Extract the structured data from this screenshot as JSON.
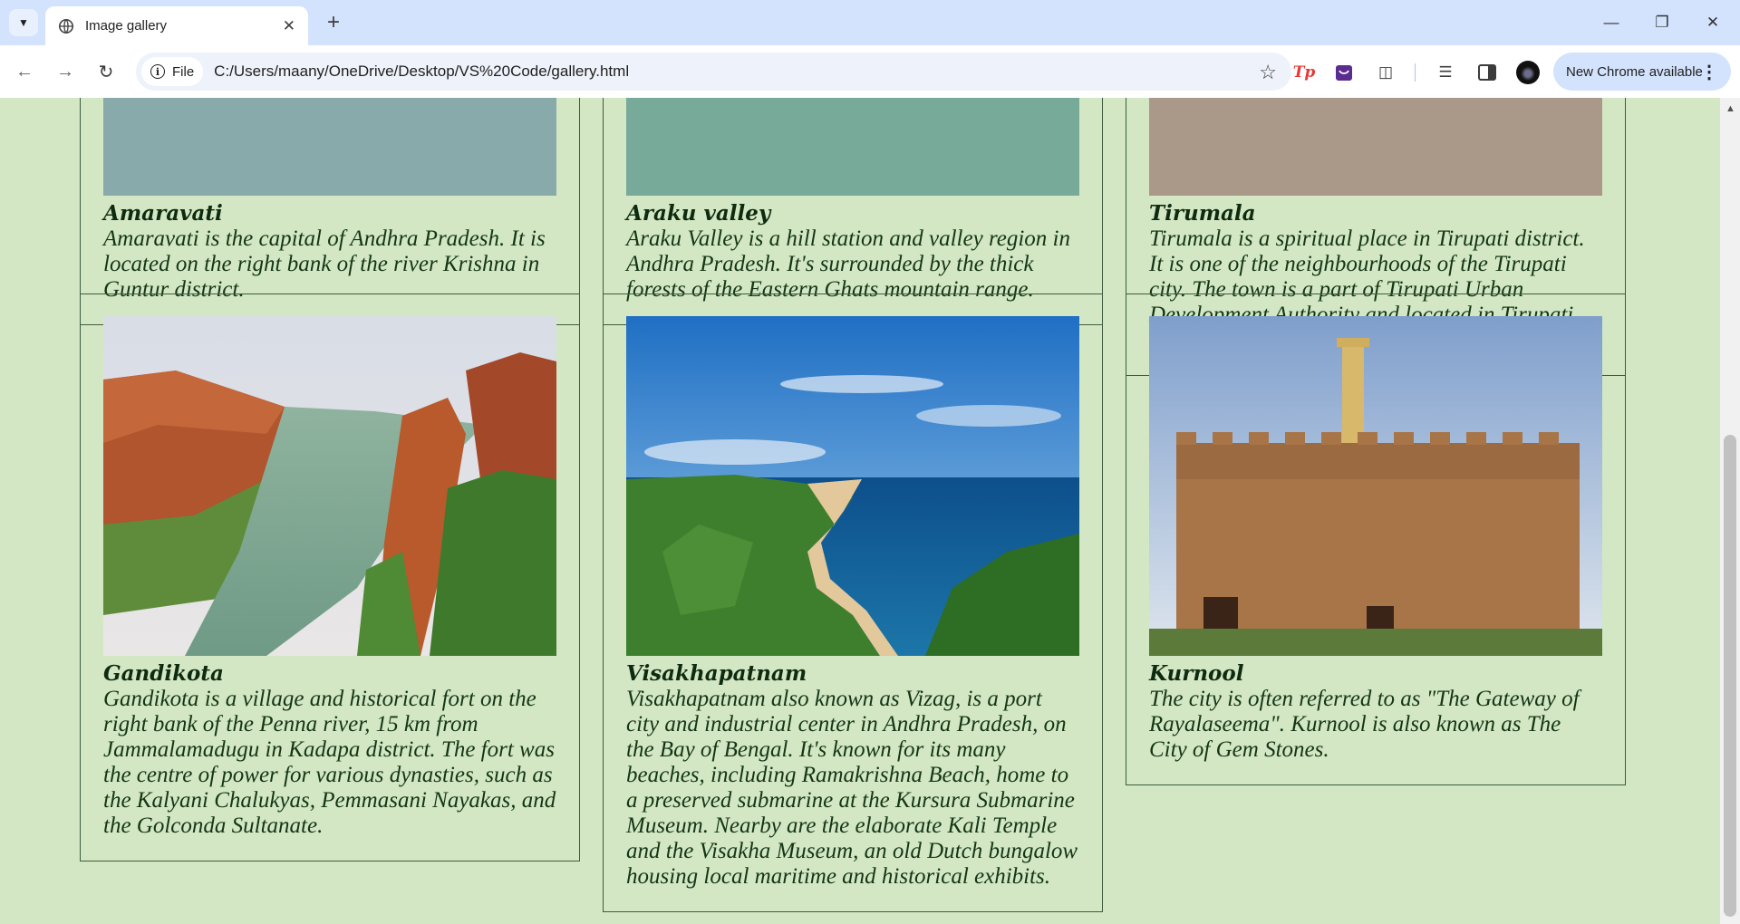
{
  "browser": {
    "tab_title": "Image gallery",
    "address_chip": "File",
    "url": "C:/Users/maany/OneDrive/Desktop/VS%20Code/gallery.html",
    "update_button": "New Chrome available"
  },
  "gallery": {
    "cards": [
      {
        "title": "Amaravati",
        "description": "Amaravati is the capital of Andhra Pradesh. It is located on the right bank of the river Krishna in Guntur district."
      },
      {
        "title": "Araku valley",
        "description": "Araku Valley is a hill station and valley region in Andhra Pradesh. It's surrounded by the thick forests of the Eastern Ghats mountain range."
      },
      {
        "title": "Tirumala",
        "description": "Tirumala is a spiritual place in Tirupati district. It is one of the neighbourhoods of the Tirupati city. The town is a part of Tirupati Urban Development Authority and located in Tirupati mandal of Tirupati revenue division."
      },
      {
        "title": "Gandikota",
        "description": "Gandikota is a village and historical fort on the right bank of the Penna river, 15 km from Jammalamadugu in Kadapa district. The fort was the centre of power for various dynasties, such as the Kalyani Chalukyas, Pemmasani Nayakas, and the Golconda Sultanate."
      },
      {
        "title": "Visakhapatnam",
        "description": "Visakhapatnam also known as Vizag, is a port city and industrial center in Andhra Pradesh, on the Bay of Bengal. It's known for its many beaches, including Ramakrishna Beach, home to a preserved submarine at the Kursura Submarine Museum. Nearby are the elaborate Kali Temple and the Visakha Museum, an old Dutch bungalow housing local maritime and historical exhibits."
      },
      {
        "title": "Kurnool",
        "description": "The city is often referred to as \"The Gateway of Rayalaseema\". Kurnool is also known as The City of Gem Stones."
      }
    ]
  }
}
